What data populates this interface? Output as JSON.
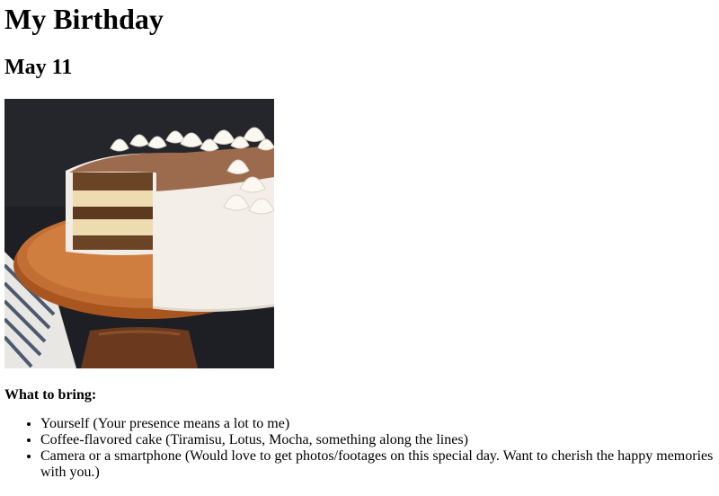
{
  "page": {
    "title": "My Birthday",
    "date": "May 11"
  },
  "image": {
    "alt": "Tiramisu-style coffee layer cake on a wooden cake stand with cream dollops",
    "colors": {
      "background": "#1d1f24",
      "wood": "#b8652c",
      "frosting": "#f1ede6",
      "cocoa": "#9c6a4c",
      "sponge": "#6b4425",
      "cream_layer": "#ecdcb0"
    }
  },
  "bring": {
    "heading": "What to bring:",
    "items": [
      "Yourself (Your presence means a lot to me)",
      "Coffee-flavored cake (Tiramisu, Lotus, Mocha, something along the lines)",
      "Camera or a smartphone (Would love to get photos/footages on this special day. Want to cherish the happy memories with you.)"
    ]
  }
}
